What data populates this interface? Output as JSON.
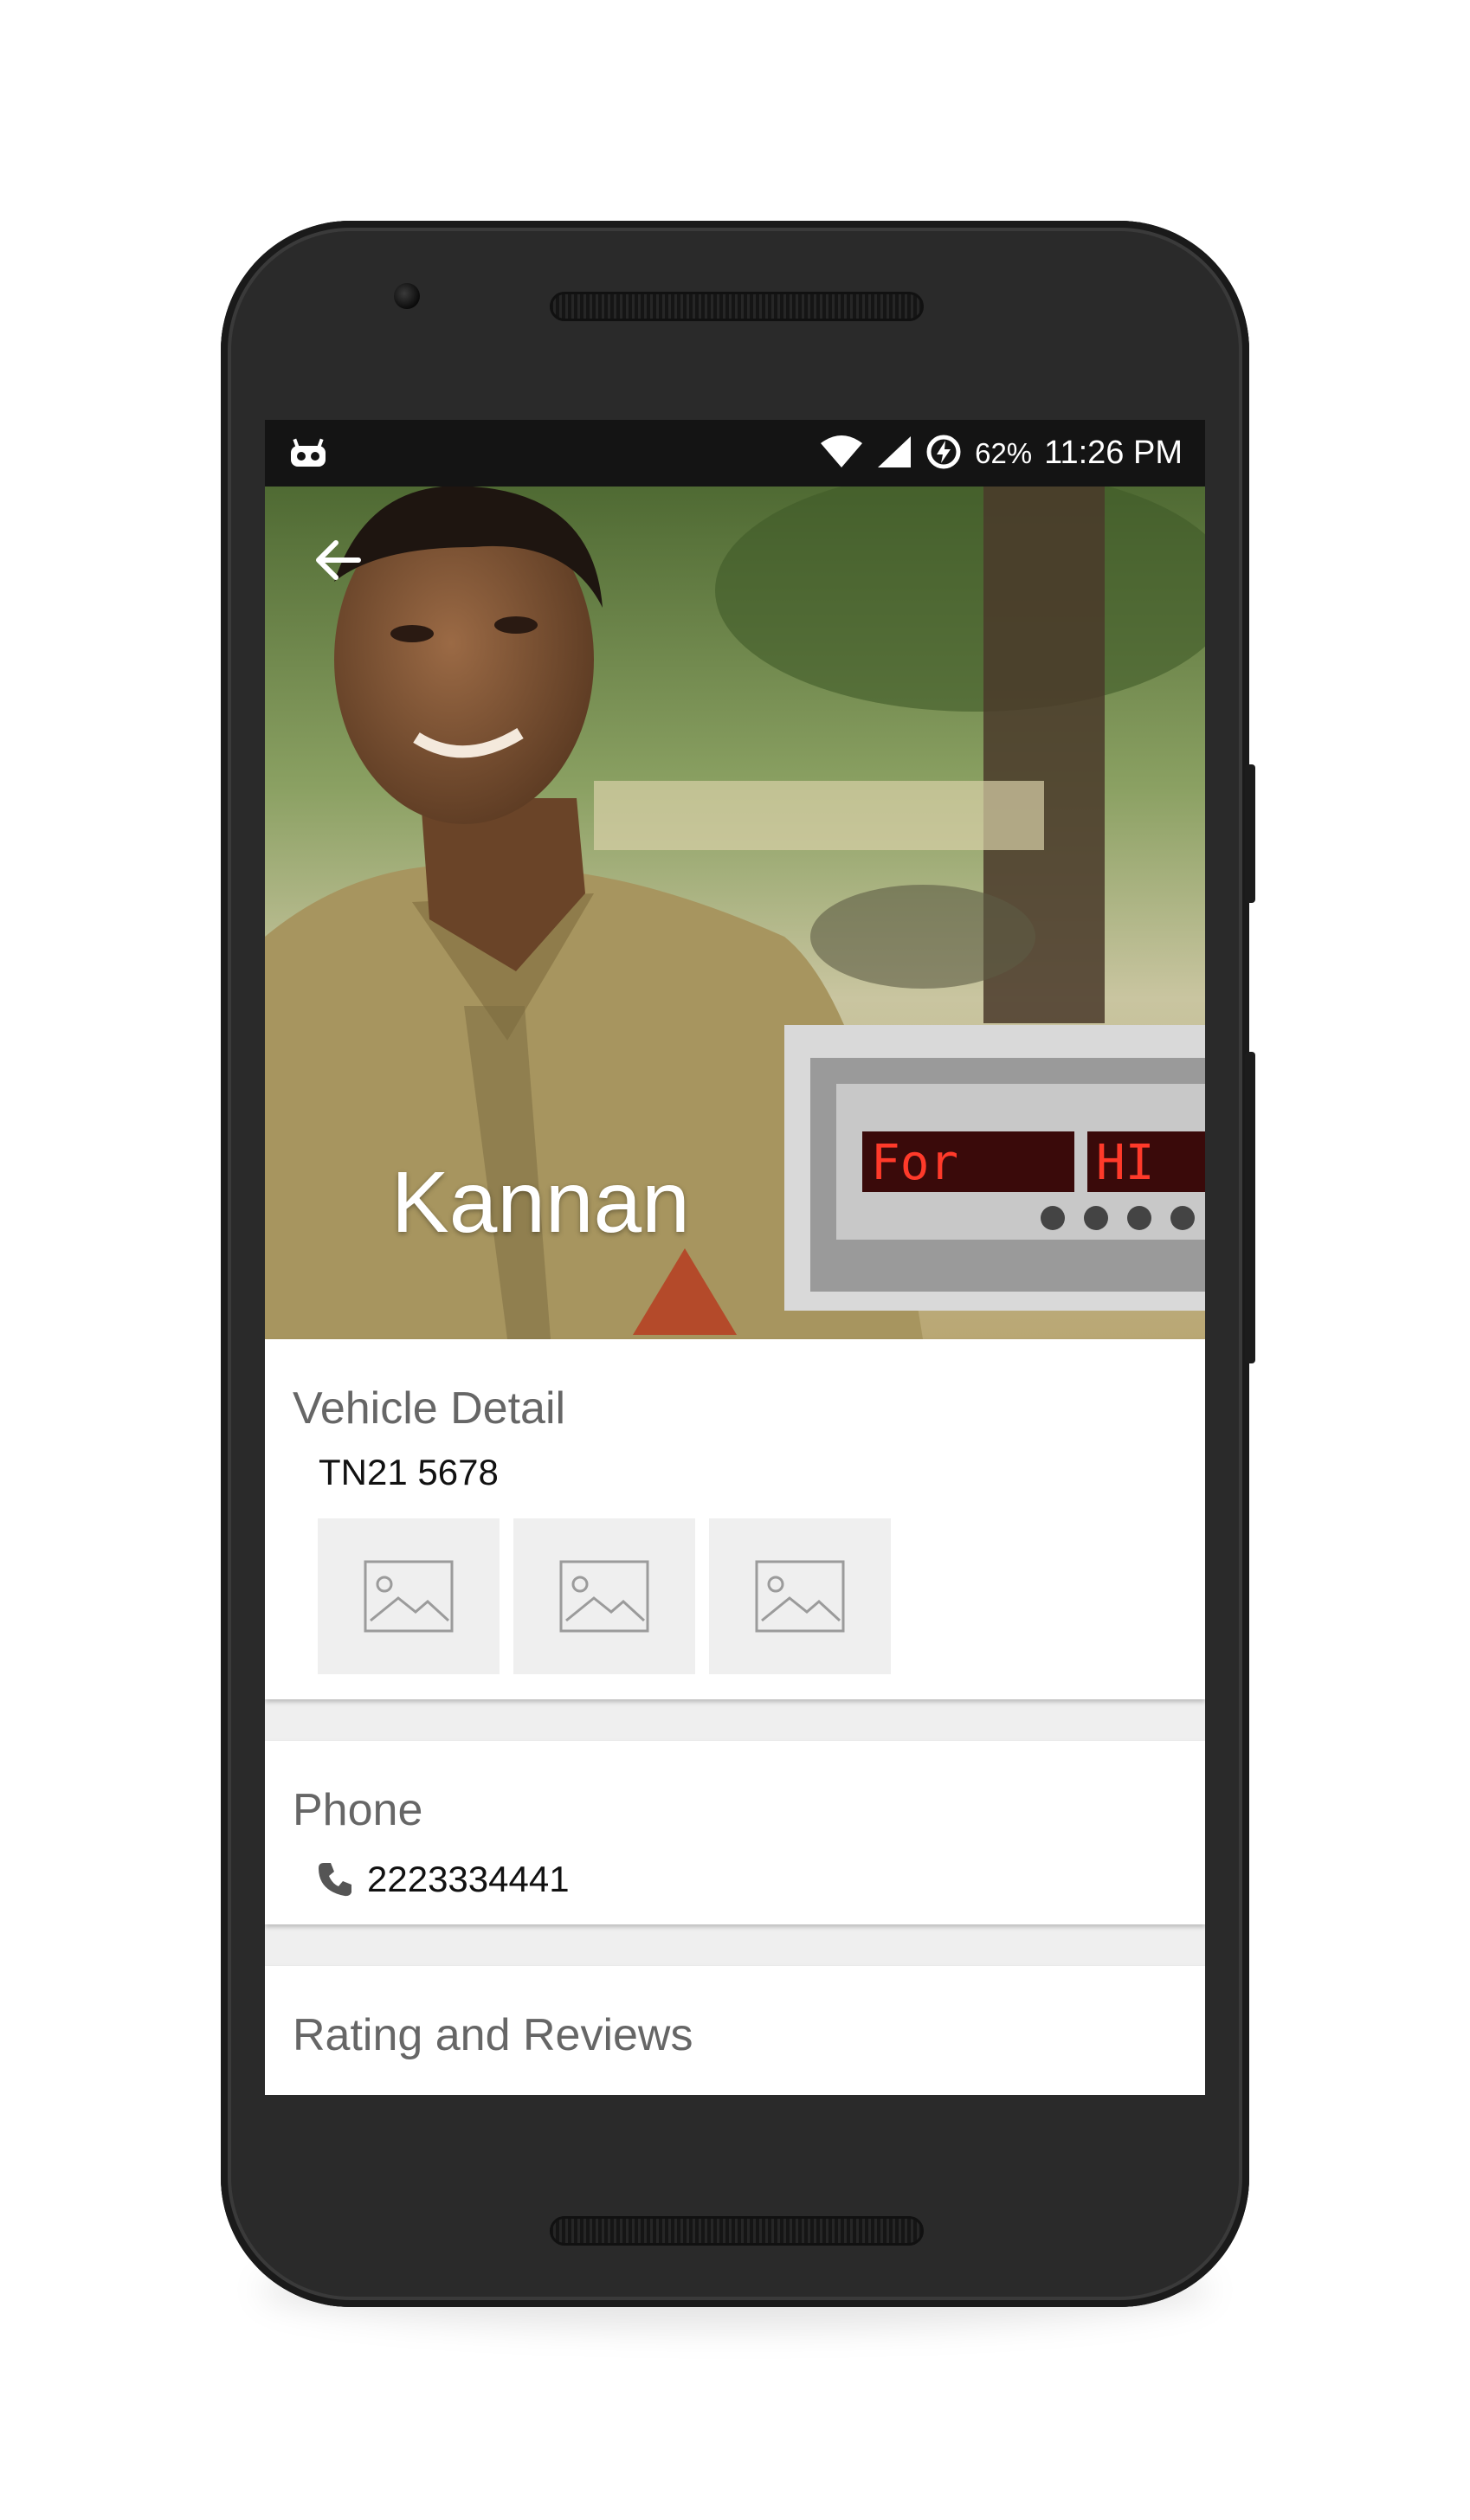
{
  "status_bar": {
    "notification_icon": "android-robot-icon",
    "wifi_icon": "wifi-icon",
    "signal_icon": "cell-signal-icon",
    "battery_icon": "battery-charging-icon",
    "battery_percent": "62%",
    "time": "11:26 PM"
  },
  "header": {
    "back_icon": "arrow-back-icon",
    "driver_name": "Kannan",
    "photo_description_icon": "driver-photo"
  },
  "vehicle_detail": {
    "title": "Vehicle Detail",
    "plate_number": "TN21 5678",
    "images": [
      "image-placeholder-icon",
      "image-placeholder-icon",
      "image-placeholder-icon"
    ]
  },
  "phone": {
    "title": "Phone",
    "icon": "phone-icon",
    "number": "2223334441"
  },
  "ratings": {
    "title": "Rating and Reviews"
  },
  "colors": {
    "phone_body": "#2a2a2a",
    "status_bar": "#141414",
    "card_background": "#ffffff",
    "page_background": "#efefef",
    "title_text": "#666666"
  }
}
